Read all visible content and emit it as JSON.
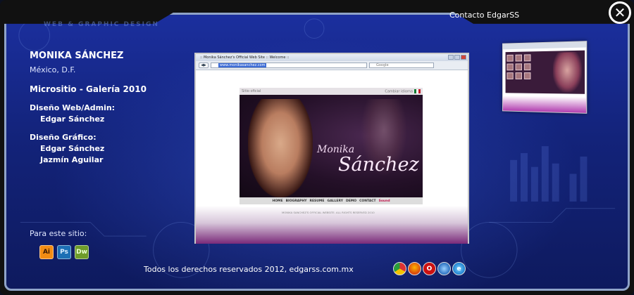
{
  "header": {
    "watermark": "WEB & GRAPHIC DESIGN",
    "contact_label": "Contacto EdgarSS",
    "close_glyph": "✕"
  },
  "info": {
    "client_name": "MONIKA SÁNCHEZ",
    "location": "México, D.F.",
    "project": "Micrositio - Galería 2010",
    "roles": [
      {
        "title": "Diseño Web/Admin:",
        "people": [
          "Edgar Sánchez"
        ]
      },
      {
        "title": "Diseño Gráfico:",
        "people": [
          "Edgar Sánchez",
          "Jazmín Aguilar"
        ]
      }
    ]
  },
  "tools": {
    "label": "Para este sitio:",
    "items": [
      {
        "name": "illustrator-icon",
        "text": "Ai"
      },
      {
        "name": "photoshop-icon",
        "text": "Ps"
      },
      {
        "name": "dreamweaver-icon",
        "text": "Dw"
      }
    ]
  },
  "footer": {
    "copyright": "Todos los derechos reservados 2012, edgarss.com.mx"
  },
  "browsers": [
    "chrome-icon",
    "firefox-icon",
    "opera-icon",
    "safari-icon",
    "ie-icon"
  ],
  "screenshot": {
    "window_title": ":: Monika Sánchez's Official Web Site :: Welcome ::",
    "url": "www.monikasanchez.com",
    "search_placeholder": "Google",
    "site_top_left": "Sitio oficial",
    "site_top_right": "Cambiar idioma",
    "name_first": "Monika",
    "name_last": "Sánchez",
    "menu": [
      "HOME",
      "BIOGRAPHY",
      "RESUME",
      "GALLERY",
      "DEMO",
      "CONTACT",
      "Sound"
    ],
    "copyright_small": "MONIKA SANCHEZ'S OFFICIAL WEBSITE. ALL RIGHTS RESERVED 2010"
  },
  "colors": {
    "panel": "#13237a",
    "accent_purple": "#7a2a79"
  }
}
